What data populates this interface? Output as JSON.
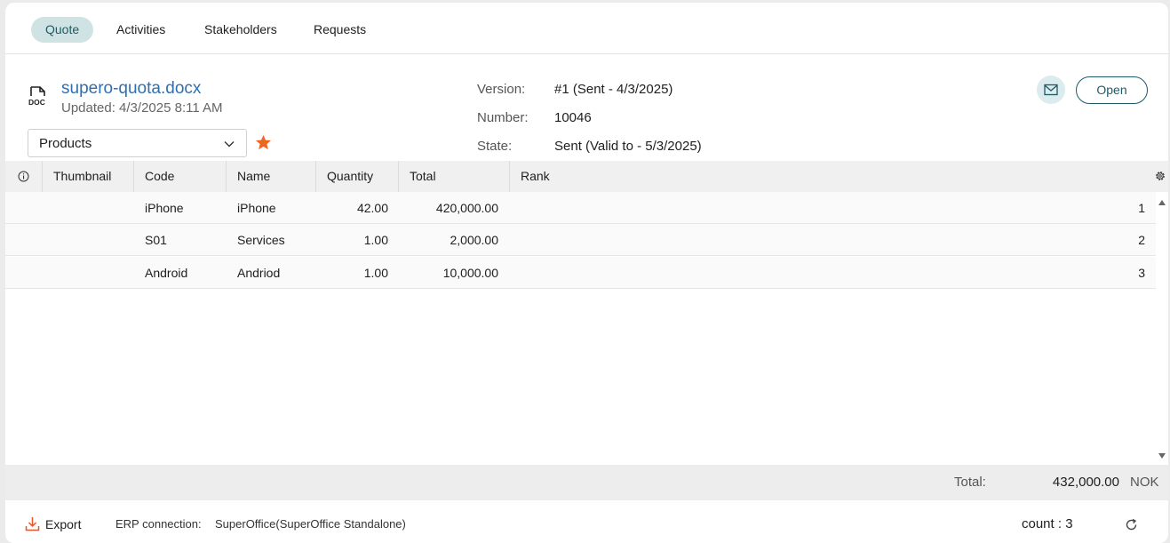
{
  "tabs": [
    {
      "label": "Quote",
      "active": true
    },
    {
      "label": "Activities",
      "active": false
    },
    {
      "label": "Stakeholders",
      "active": false
    },
    {
      "label": "Requests",
      "active": false
    }
  ],
  "document": {
    "icon": "doc-icon",
    "title": "supero-quota.docx",
    "updated": "Updated: 4/3/2025 8:11 AM"
  },
  "selector": {
    "value": "Products"
  },
  "favorite": {
    "icon": "star-icon",
    "color": "#f0661f"
  },
  "meta": [
    {
      "label": "Version:",
      "value": "#1 (Sent - 4/3/2025)"
    },
    {
      "label": "Number:",
      "value": "10046"
    },
    {
      "label": "State:",
      "value": "Sent (Valid to - 5/3/2025)"
    }
  ],
  "actions": {
    "mail_icon": "mail-icon",
    "open_label": "Open"
  },
  "grid": {
    "columns": [
      "Thumbnail",
      "Code",
      "Name",
      "Quantity",
      "Total",
      "Rank"
    ],
    "rows": [
      {
        "code": "iPhone",
        "name": "iPhone",
        "quantity": "42.00",
        "total": "420,000.00",
        "rank": "1"
      },
      {
        "code": "S01",
        "name": "Services",
        "quantity": "1.00",
        "total": "2,000.00",
        "rank": "2"
      },
      {
        "code": "Android",
        "name": "Andriod",
        "quantity": "1.00",
        "total": "10,000.00",
        "rank": "3"
      }
    ]
  },
  "totals": {
    "label": "Total:",
    "amount": "432,000.00",
    "currency": "NOK"
  },
  "footer": {
    "export_label": "Export",
    "erp_label": "ERP connection:",
    "erp_value": "SuperOffice(SuperOffice Standalone)",
    "count": "count : 3"
  },
  "colors": {
    "accent": "#1c5a66",
    "tab_active_bg": "#cfe3e4",
    "link": "#2f6fb0",
    "star": "#f0661f",
    "export_icon": "#e5562a"
  }
}
